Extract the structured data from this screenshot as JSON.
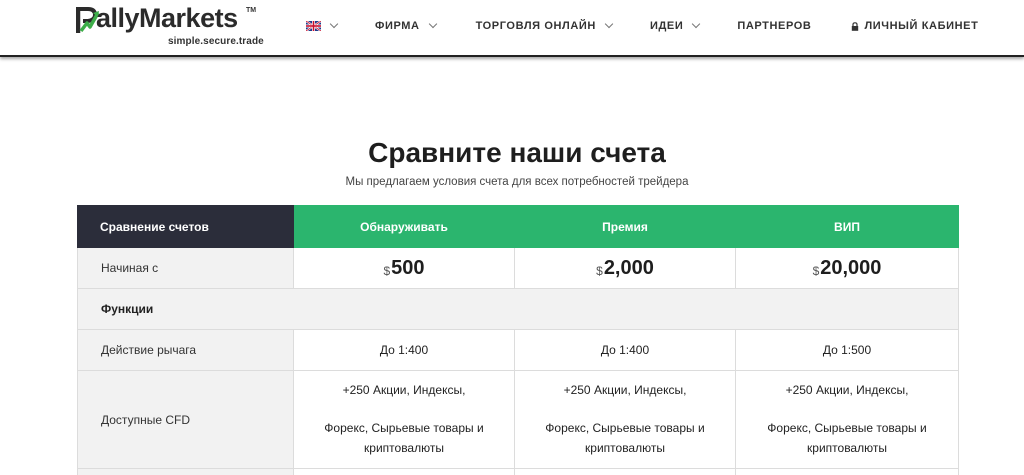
{
  "header": {
    "logo": {
      "word": "allyMarkets",
      "tm": "TM",
      "tagline": "simple.secure.trade"
    },
    "nav": [
      {
        "label": "",
        "has_dropdown": true,
        "icon": "uk-flag-icon"
      },
      {
        "label": "ФИРМА",
        "has_dropdown": true
      },
      {
        "label": "ТОРГОВЛЯ ОНЛАЙН",
        "has_dropdown": true
      },
      {
        "label": "ИДЕИ",
        "has_dropdown": true
      },
      {
        "label": "ПАРТНЕРОВ",
        "has_dropdown": false
      },
      {
        "label": "ЛИЧНЫЙ КАБИНЕТ",
        "has_dropdown": false,
        "icon": "lock-icon"
      }
    ]
  },
  "main": {
    "title": "Сравните наши счета",
    "subtitle": "Мы предлагаем условия счета для всех потребностей трейдера"
  },
  "table": {
    "header": [
      "Сравнение счетов",
      "Обнаруживать",
      "Премия",
      "ВИП"
    ],
    "price_row": {
      "label": "Начиная с",
      "currency": "$",
      "values": [
        "500",
        "2,000",
        "20,000"
      ]
    },
    "section": "Функции",
    "leverage_row": {
      "label": "Действие рычага",
      "values": [
        "До 1:400",
        "До 1:400",
        "До 1:500"
      ]
    },
    "cfd_row": {
      "label": "Доступные CFD",
      "line1": "+250 Акции, Индексы,",
      "line2a": "Форекс, Сырьевые товары и",
      "line2b": "криптовалюты"
    }
  },
  "colors": {
    "accent": "#2bb56e",
    "dark": "#2b2d3a",
    "logo_green": "#3dae49"
  }
}
